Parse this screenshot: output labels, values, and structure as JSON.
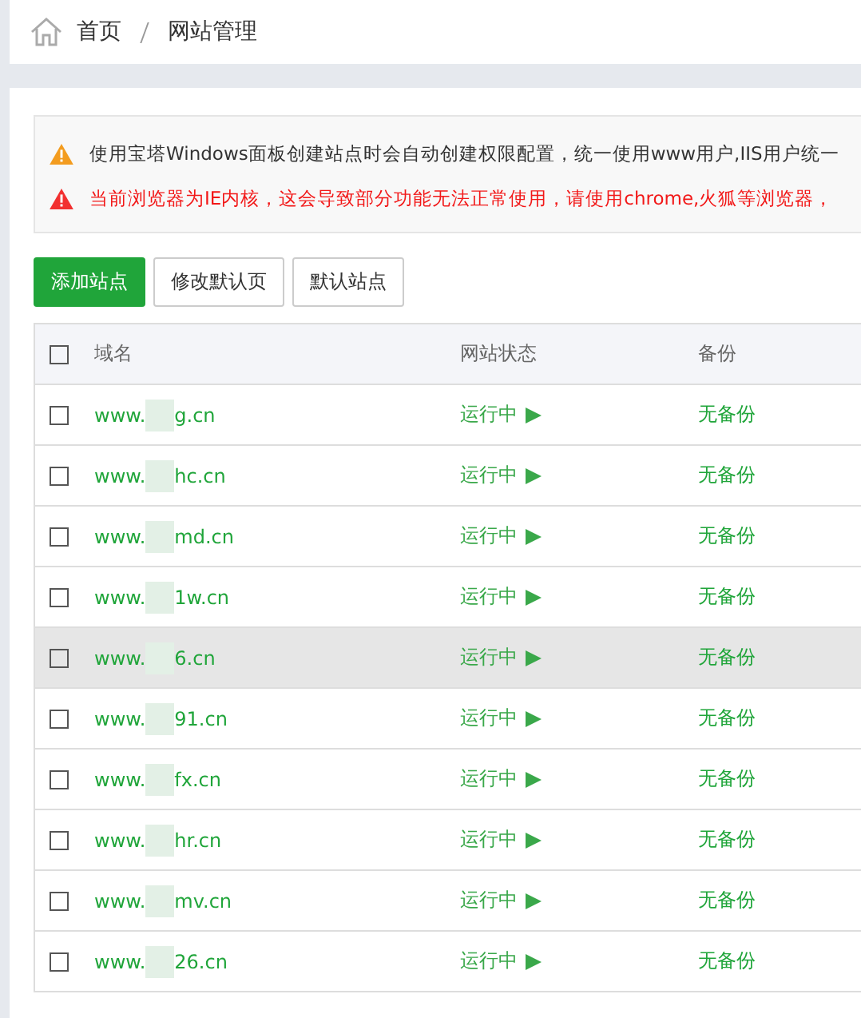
{
  "breadcrumb": [
    "首页",
    "网站管理"
  ],
  "alerts": [
    {
      "kind": "warning",
      "text": "使用宝塔Windows面板创建站点时会自动创建权限配置，统一使用www用户,IIS用户统一"
    },
    {
      "kind": "danger",
      "text": "当前浏览器为IE内核，这会导致部分功能无法正常使用，请使用chrome,火狐等浏览器，"
    }
  ],
  "buttons": [
    {
      "label": "添加站点",
      "kind": "primary"
    },
    {
      "label": "修改默认页",
      "kind": "default"
    },
    {
      "label": "默认站点",
      "kind": "default"
    }
  ],
  "table": {
    "columns": [
      "域名",
      "网站状态",
      "备份"
    ],
    "select_all_checked": false,
    "rows": [
      {
        "domain_start": "www.",
        "domain_end": "g.cn",
        "status": "运行中",
        "backup": "无备份",
        "checked": false,
        "highlighted": false
      },
      {
        "domain_start": "www.",
        "domain_end": "hc.cn",
        "status": "运行中",
        "backup": "无备份",
        "checked": false,
        "highlighted": false
      },
      {
        "domain_start": "www.",
        "domain_end": "md.cn",
        "status": "运行中",
        "backup": "无备份",
        "checked": false,
        "highlighted": false
      },
      {
        "domain_start": "www.",
        "domain_end": "1w.cn",
        "status": "运行中",
        "backup": "无备份",
        "checked": false,
        "highlighted": false
      },
      {
        "domain_start": "www.",
        "domain_end": "6.cn",
        "status": "运行中",
        "backup": "无备份",
        "checked": false,
        "highlighted": true
      },
      {
        "domain_start": "www.",
        "domain_end": "91.cn",
        "status": "运行中",
        "backup": "无备份",
        "checked": false,
        "highlighted": false
      },
      {
        "domain_start": "www.",
        "domain_end": "fx.cn",
        "status": "运行中",
        "backup": "无备份",
        "checked": false,
        "highlighted": false
      },
      {
        "domain_start": "www.",
        "domain_end": "hr.cn",
        "status": "运行中",
        "backup": "无备份",
        "checked": false,
        "highlighted": false
      },
      {
        "domain_start": "www.",
        "domain_end": "mv.cn",
        "status": "运行中",
        "backup": "无备份",
        "checked": false,
        "highlighted": false
      },
      {
        "domain_start": "www.",
        "domain_end": "26.cn",
        "status": "运行中",
        "backup": "无备份",
        "checked": false,
        "highlighted": false
      }
    ]
  }
}
